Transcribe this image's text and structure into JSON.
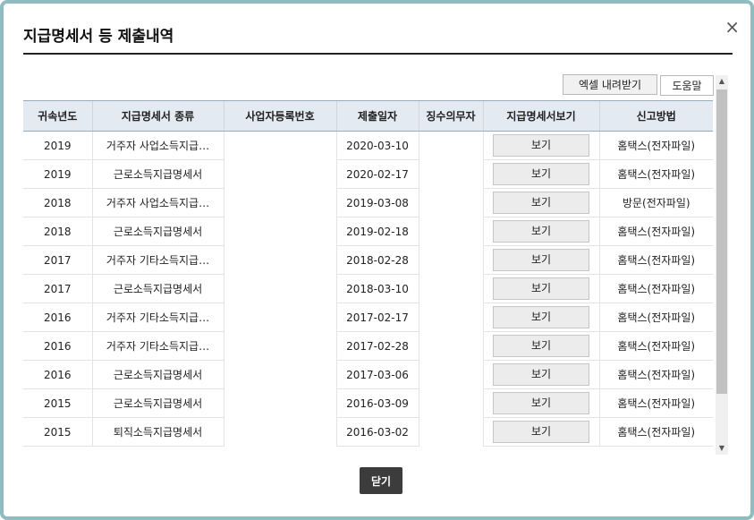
{
  "dialog": {
    "title": "지급명세서 등 제출내역",
    "close_icon": "×",
    "excel_button": "엑셀 내려받기",
    "help_button": "도움말",
    "close_button": "닫기"
  },
  "table": {
    "headers": [
      "귀속년도",
      "지급명세서 종류",
      "사업자등록번호",
      "제출일자",
      "징수의무자",
      "지급명세서보기",
      "신고방법"
    ],
    "view_label": "보기",
    "rows": [
      {
        "year": "2019",
        "type": "거주자 사업소득지급…",
        "bizno": "",
        "date": "2020-03-10",
        "collector": "",
        "method": "홈택스(전자파일)"
      },
      {
        "year": "2019",
        "type": "근로소득지급명세서",
        "bizno": "",
        "date": "2020-02-17",
        "collector": "",
        "method": "홈택스(전자파일)"
      },
      {
        "year": "2018",
        "type": "거주자 사업소득지급…",
        "bizno": "",
        "date": "2019-03-08",
        "collector": "",
        "method": "방문(전자파일)"
      },
      {
        "year": "2018",
        "type": "근로소득지급명세서",
        "bizno": "",
        "date": "2019-02-18",
        "collector": "",
        "method": "홈택스(전자파일)"
      },
      {
        "year": "2017",
        "type": "거주자 기타소득지급…",
        "bizno": "",
        "date": "2018-02-28",
        "collector": "",
        "method": "홈택스(전자파일)"
      },
      {
        "year": "2017",
        "type": "근로소득지급명세서",
        "bizno": "",
        "date": "2018-03-10",
        "collector": "",
        "method": "홈택스(전자파일)"
      },
      {
        "year": "2016",
        "type": "거주자 기타소득지급…",
        "bizno": "",
        "date": "2017-02-17",
        "collector": "",
        "method": "홈택스(전자파일)"
      },
      {
        "year": "2016",
        "type": "거주자 기타소득지급…",
        "bizno": "",
        "date": "2017-02-28",
        "collector": "",
        "method": "홈택스(전자파일)"
      },
      {
        "year": "2016",
        "type": "근로소득지급명세서",
        "bizno": "",
        "date": "2017-03-06",
        "collector": "",
        "method": "홈택스(전자파일)"
      },
      {
        "year": "2015",
        "type": "근로소득지급명세서",
        "bizno": "",
        "date": "2016-03-09",
        "collector": "",
        "method": "홈택스(전자파일)"
      },
      {
        "year": "2015",
        "type": "퇴직소득지급명세서",
        "bizno": "",
        "date": "2016-03-02",
        "collector": "",
        "method": "홈택스(전자파일)"
      }
    ]
  },
  "scrollbar": {
    "up_icon": "▲",
    "down_icon": "▼"
  }
}
